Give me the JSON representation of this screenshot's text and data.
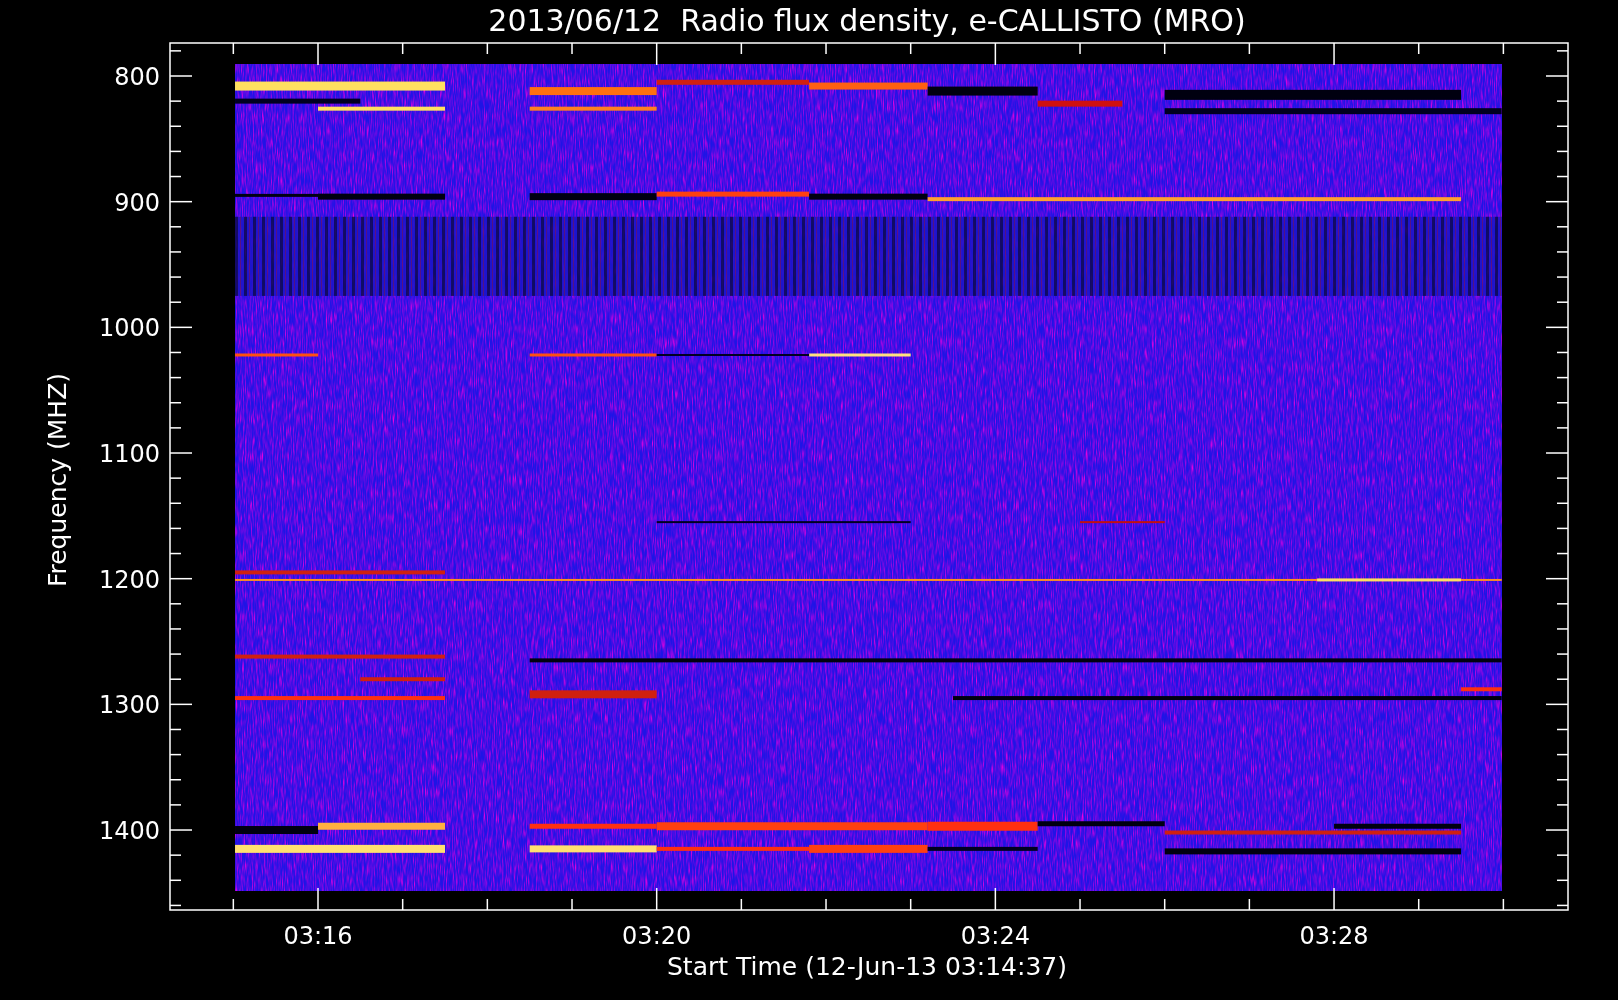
{
  "title": "2013/06/12  Radio flux density, e-CALLISTO (MRO)",
  "y_axis": {
    "label": "Frequency (MHZ)",
    "ticks": [
      "800",
      "900",
      "1000",
      "1100",
      "1200",
      "1300",
      "1400"
    ]
  },
  "x_axis": {
    "label": "Start Time (12-Jun-13 03:14:37)",
    "ticks": [
      "03:16",
      "03:20",
      "03:24",
      "03:28"
    ]
  }
}
